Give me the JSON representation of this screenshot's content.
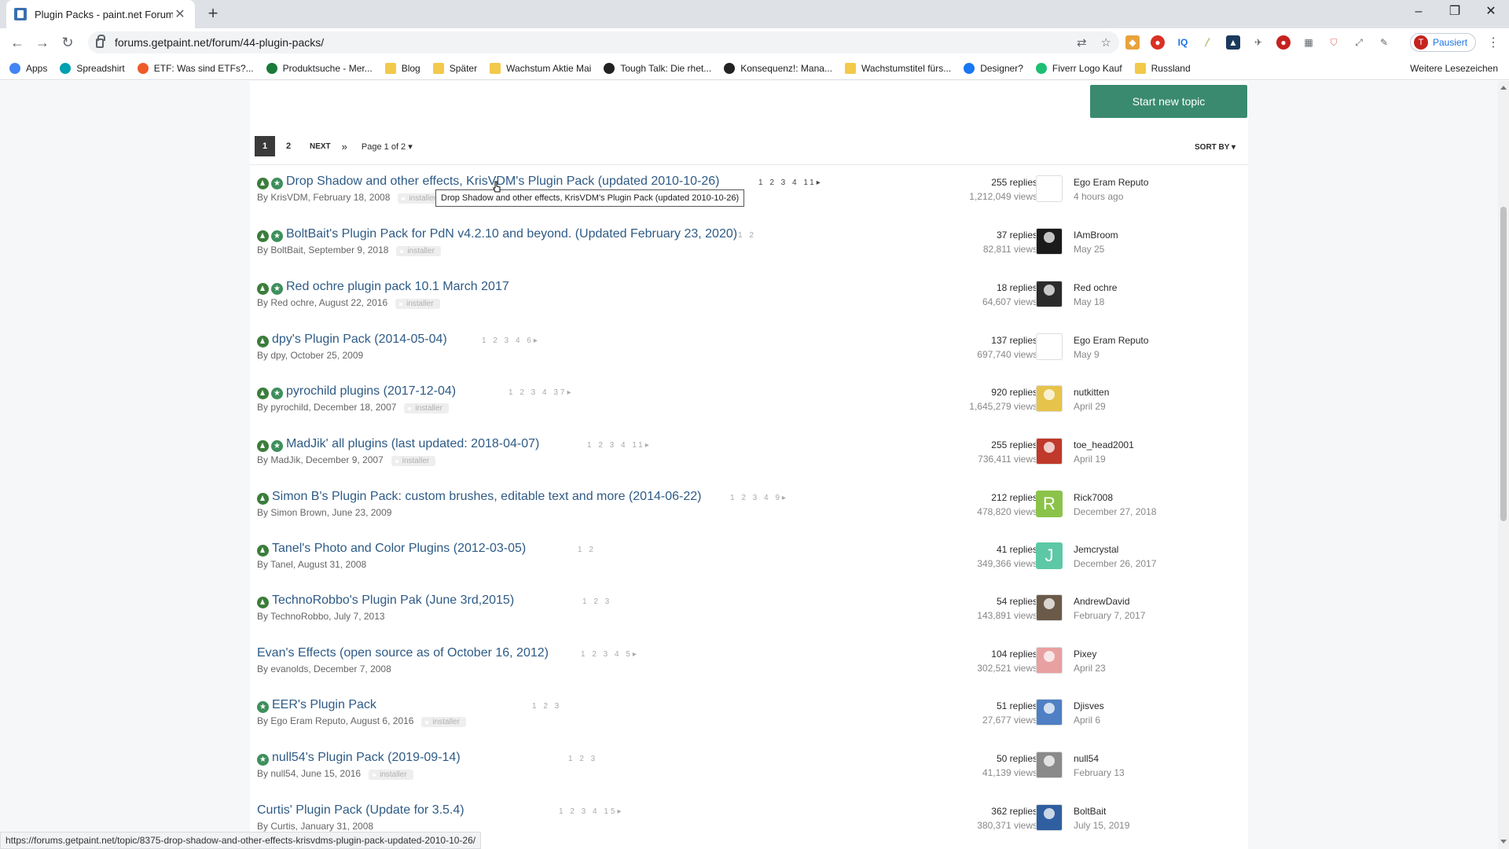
{
  "browser": {
    "tab_title": "Plugin Packs - paint.net Forum",
    "url": "forums.getpaint.net/forum/44-plugin-packs/",
    "profile_label": "Pausiert",
    "profile_initial": "T",
    "status_url": "https://forums.getpaint.net/topic/8375-drop-shadow-and-other-effects-krisvdms-plugin-pack-updated-2010-10-26/"
  },
  "bookmarks": [
    {
      "label": "Apps",
      "icon": "apps-grid-icon"
    },
    {
      "label": "Spreadshirt",
      "icon": "spreadshirt-icon"
    },
    {
      "label": "ETF: Was sind ETFs?...",
      "icon": "etf-icon"
    },
    {
      "label": "Produktsuche - Mer...",
      "icon": "produktsuche-icon"
    },
    {
      "label": "Blog",
      "icon": "folder-icon"
    },
    {
      "label": "Später",
      "icon": "folder-icon"
    },
    {
      "label": "Wachstum Aktie Mai",
      "icon": "folder-icon"
    },
    {
      "label": "Tough Talk: Die rhet...",
      "icon": "amazon-icon"
    },
    {
      "label": "Konsequenz!: Mana...",
      "icon": "amazon-icon"
    },
    {
      "label": "Wachstumstitel fürs...",
      "icon": "folder-icon"
    },
    {
      "label": "Designer?",
      "icon": "facebook-icon"
    },
    {
      "label": "Fiverr Logo Kauf",
      "icon": "fiverr-icon"
    },
    {
      "label": "Russland",
      "icon": "folder-icon"
    }
  ],
  "bookmarks_other": "Weitere Lesezeichen",
  "forum": {
    "start_topic_label": "Start new topic",
    "pager": {
      "pages": [
        "1",
        "2"
      ],
      "next": "NEXT",
      "last": "»",
      "page_of": "Page 1 of 2"
    },
    "sort_by": "SORT BY",
    "tooltip": "Drop Shadow and other effects, KrisVDM's Plugin Pack (updated 2010-10-26)",
    "topics": [
      {
        "title": "Drop Shadow and other effects, KrisVDM's Plugin Pack (updated 2010-10-26)",
        "pages": "1 2 3 4 11▸",
        "author_line": "By KrisVDM, February 18, 2008",
        "tag": "installer",
        "replies": "255 replies",
        "views": "1,212,049 views",
        "last_user": "Ego Eram Reputo",
        "last_date": "4 hours ago",
        "pinned": true,
        "featured": true
      },
      {
        "title": "BoltBait's Plugin Pack for PdN v4.2.10 and beyond. (Updated February 23, 2020)",
        "pages": "1 2",
        "author_line": "By BoltBait, September 9, 2018",
        "tag": "installer",
        "replies": "37 replies",
        "views": "82,811 views",
        "last_user": "IAmBroom",
        "last_date": "May 25",
        "pinned": true,
        "featured": true
      },
      {
        "title": "Red ochre plugin pack 10.1 March 2017",
        "pages": "",
        "author_line": "By Red ochre, August 22, 2016",
        "tag": "installer",
        "replies": "18 replies",
        "views": "64,607 views",
        "last_user": "Red ochre",
        "last_date": "May 18",
        "pinned": true,
        "featured": true
      },
      {
        "title": "dpy's Plugin Pack (2014-05-04)",
        "pages": "1 2 3 4 6▸",
        "author_line": "By dpy, October 25, 2009",
        "tag": "",
        "replies": "137 replies",
        "views": "697,740 views",
        "last_user": "Ego Eram Reputo",
        "last_date": "May 9",
        "pinned": true,
        "featured": false
      },
      {
        "title": "pyrochild plugins (2017-12-04)",
        "pages": "1 2 3 4 37▸",
        "author_line": "By pyrochild, December 18, 2007",
        "tag": "installer",
        "replies": "920 replies",
        "views": "1,645,279 views",
        "last_user": "nutkitten",
        "last_date": "April 29",
        "pinned": true,
        "featured": true
      },
      {
        "title": "MadJik' all plugins (last updated: 2018-04-07)",
        "pages": "1 2 3 4 11▸",
        "author_line": "By MadJik, December 9, 2007",
        "tag": "installer",
        "replies": "255 replies",
        "views": "736,411 views",
        "last_user": "toe_head2001",
        "last_date": "April 19",
        "pinned": true,
        "featured": true
      },
      {
        "title": "Simon B's Plugin Pack: custom brushes, editable text and more (2014-06-22)",
        "pages": "1 2 3 4 9▸",
        "author_line": "By Simon Brown, June 23, 2009",
        "tag": "",
        "replies": "212 replies",
        "views": "478,820 views",
        "last_user": "Rick7008",
        "last_date": "December 27, 2018",
        "pinned": true,
        "featured": false
      },
      {
        "title": "Tanel's Photo and Color Plugins (2012-03-05)",
        "pages": "1 2",
        "author_line": "By Tanel, August 31, 2008",
        "tag": "",
        "replies": "41 replies",
        "views": "349,366 views",
        "last_user": "Jemcrystal",
        "last_date": "December 26, 2017",
        "pinned": true,
        "featured": false
      },
      {
        "title": "TechnoRobbo's Plugin Pak (June 3rd,2015)",
        "pages": "1 2 3",
        "author_line": "By TechnoRobbo, July 7, 2013",
        "tag": "",
        "replies": "54 replies",
        "views": "143,891 views",
        "last_user": "AndrewDavid",
        "last_date": "February 7, 2017",
        "pinned": true,
        "featured": false
      },
      {
        "title": "Evan's Effects (open source as of October 16, 2012)",
        "pages": "1 2 3 4 5▸",
        "author_line": "By evanolds, December 7, 2008",
        "tag": "",
        "replies": "104 replies",
        "views": "302,521 views",
        "last_user": "Pixey",
        "last_date": "April 23",
        "pinned": false,
        "featured": false
      },
      {
        "title": "EER's Plugin Pack",
        "pages": "1 2 3",
        "author_line": "By Ego Eram Reputo, August 6, 2016",
        "tag": "installer",
        "replies": "51 replies",
        "views": "27,677 views",
        "last_user": "Djisves",
        "last_date": "April 6",
        "pinned": false,
        "featured": true
      },
      {
        "title": "null54's Plugin Pack (2019-09-14)",
        "pages": "1 2 3",
        "author_line": "By null54, June 15, 2016",
        "tag": "installer",
        "replies": "50 replies",
        "views": "41,139 views",
        "last_user": "null54",
        "last_date": "February 13",
        "pinned": false,
        "featured": true
      },
      {
        "title": "Curtis' Plugin Pack (Update for 3.5.4)",
        "pages": "1 2 3 4 15▸",
        "author_line": "By Curtis, January 31, 2008",
        "tag": "",
        "replies": "362 replies",
        "views": "380,371 views",
        "last_user": "BoltBait",
        "last_date": "July 15, 2019",
        "pinned": false,
        "featured": false
      }
    ]
  },
  "colors": {
    "accent_button": "#3a8a70",
    "link": "#2e5b86",
    "pinned_icon": "#3b7d3b",
    "featured_icon": "#3e8f5c"
  },
  "avatar_letters": {
    "Rick7008": "R",
    "Jemcrystal": "J"
  },
  "avatar_colors": [
    "#ffffff",
    "#1b1b1b",
    "#2b2b2b",
    "#ffffff",
    "#e6c34a",
    "#c0392b",
    "#8bc34a",
    "#5dc8a6",
    "#6b5a4a",
    "#e8a0a0",
    "#4f7fc4",
    "#8a8a8a",
    "#2f5fa0"
  ]
}
